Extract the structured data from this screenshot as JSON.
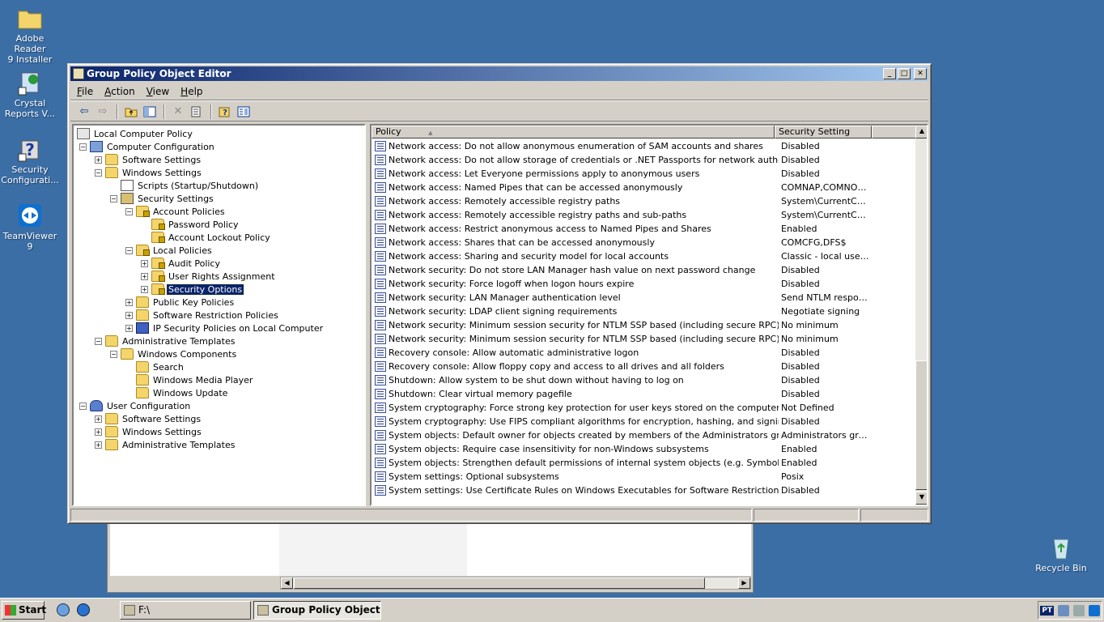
{
  "desktop": {
    "icons": [
      {
        "label": "Adobe Reader\n9 Installer",
        "icon": "folder-icon"
      },
      {
        "label": "Crystal\nReports V...",
        "icon": "crystal-reports-icon"
      },
      {
        "label": "Security\nConfigurati...",
        "icon": "security-config-icon"
      },
      {
        "label": "TeamViewer 9",
        "icon": "teamviewer-icon"
      },
      {
        "label": "Recycle Bin",
        "icon": "recycle-bin-icon"
      }
    ]
  },
  "window": {
    "title": "Group Policy Object Editor",
    "controls": {
      "minimize": "_",
      "maximize": "□",
      "close": "✕"
    },
    "menus": [
      "File",
      "Action",
      "View",
      "Help"
    ],
    "toolbar_icons": [
      "back-icon",
      "forward-icon",
      "up-folder-icon",
      "show-hide-tree-icon",
      "delete-icon",
      "export-list-icon",
      "help-icon",
      "properties-icon"
    ],
    "tree": [
      {
        "label": "Local Computer Policy",
        "depth": 0,
        "expander": "",
        "icon": "policy"
      },
      {
        "label": "Computer Configuration",
        "depth": 1,
        "expander": "−",
        "icon": "computer"
      },
      {
        "label": "Software Settings",
        "depth": 2,
        "expander": "+",
        "icon": "folder"
      },
      {
        "label": "Windows Settings",
        "depth": 2,
        "expander": "−",
        "icon": "folder"
      },
      {
        "label": "Scripts (Startup/Shutdown)",
        "depth": 3,
        "expander": "",
        "icon": "doc"
      },
      {
        "label": "Security Settings",
        "depth": 3,
        "expander": "−",
        "icon": "sec"
      },
      {
        "label": "Account Policies",
        "depth": 4,
        "expander": "−",
        "icon": "folderlock"
      },
      {
        "label": "Password Policy",
        "depth": 5,
        "expander": "",
        "icon": "folderlock"
      },
      {
        "label": "Account Lockout Policy",
        "depth": 5,
        "expander": "",
        "icon": "folderlock"
      },
      {
        "label": "Local Policies",
        "depth": 4,
        "expander": "−",
        "icon": "folderlock"
      },
      {
        "label": "Audit Policy",
        "depth": 5,
        "expander": "+",
        "icon": "folderlock"
      },
      {
        "label": "User Rights Assignment",
        "depth": 5,
        "expander": "+",
        "icon": "folderlock"
      },
      {
        "label": "Security Options",
        "depth": 5,
        "expander": "+",
        "icon": "folderlock",
        "selected": true
      },
      {
        "label": "Public Key Policies",
        "depth": 4,
        "expander": "+",
        "icon": "folder"
      },
      {
        "label": "Software Restriction Policies",
        "depth": 4,
        "expander": "+",
        "icon": "folder"
      },
      {
        "label": "IP Security Policies on Local Computer",
        "depth": 4,
        "expander": "+",
        "icon": "ip"
      },
      {
        "label": "Administrative Templates",
        "depth": 2,
        "expander": "−",
        "icon": "folder"
      },
      {
        "label": "Windows Components",
        "depth": 3,
        "expander": "−",
        "icon": "folder"
      },
      {
        "label": "Search",
        "depth": 4,
        "expander": "",
        "icon": "folder"
      },
      {
        "label": "Windows Media Player",
        "depth": 4,
        "expander": "",
        "icon": "folder"
      },
      {
        "label": "Windows Update",
        "depth": 4,
        "expander": "",
        "icon": "folder"
      },
      {
        "label": "User Configuration",
        "depth": 1,
        "expander": "−",
        "icon": "user"
      },
      {
        "label": "Software Settings",
        "depth": 2,
        "expander": "+",
        "icon": "folder"
      },
      {
        "label": "Windows Settings",
        "depth": 2,
        "expander": "+",
        "icon": "folder"
      },
      {
        "label": "Administrative Templates",
        "depth": 2,
        "expander": "+",
        "icon": "folder"
      }
    ],
    "list": {
      "columns": [
        "Policy",
        "Security Setting"
      ],
      "sort_indicator": "▲",
      "rows": [
        {
          "policy": "Network access: Do not allow anonymous enumeration of SAM accounts and shares",
          "setting": "Disabled"
        },
        {
          "policy": "Network access: Do not allow storage of credentials or .NET Passports for network authentication",
          "setting": "Disabled"
        },
        {
          "policy": "Network access: Let Everyone permissions apply to anonymous users",
          "setting": "Disabled"
        },
        {
          "policy": "Network access: Named Pipes that can be accessed anonymously",
          "setting": "COMNAP,COMNOD..."
        },
        {
          "policy": "Network access: Remotely accessible registry paths",
          "setting": "System\\CurrentCon..."
        },
        {
          "policy": "Network access: Remotely accessible registry paths and sub-paths",
          "setting": "System\\CurrentCon..."
        },
        {
          "policy": "Network access: Restrict anonymous access to Named Pipes and Shares",
          "setting": "Enabled"
        },
        {
          "policy": "Network access: Shares that can be accessed anonymously",
          "setting": "COMCFG,DFS$"
        },
        {
          "policy": "Network access: Sharing and security model for local accounts",
          "setting": "Classic - local users ..."
        },
        {
          "policy": "Network security: Do not store LAN Manager hash value on next password change",
          "setting": "Disabled"
        },
        {
          "policy": "Network security: Force logoff when logon hours expire",
          "setting": "Disabled"
        },
        {
          "policy": "Network security: LAN Manager authentication level",
          "setting": "Send NTLM respons..."
        },
        {
          "policy": "Network security: LDAP client signing requirements",
          "setting": "Negotiate signing"
        },
        {
          "policy": "Network security: Minimum session security for NTLM SSP based (including secure RPC) clients",
          "setting": "No minimum"
        },
        {
          "policy": "Network security: Minimum session security for NTLM SSP based (including secure RPC) servers",
          "setting": "No minimum"
        },
        {
          "policy": "Recovery console: Allow automatic administrative logon",
          "setting": "Disabled"
        },
        {
          "policy": "Recovery console: Allow floppy copy and access to all drives and all folders",
          "setting": "Disabled"
        },
        {
          "policy": "Shutdown: Allow system to be shut down without having to log on",
          "setting": "Disabled"
        },
        {
          "policy": "Shutdown: Clear virtual memory pagefile",
          "setting": "Disabled"
        },
        {
          "policy": "System cryptography: Force strong key protection for user keys stored on the computer",
          "setting": "Not Defined"
        },
        {
          "policy": "System cryptography: Use FIPS compliant algorithms for encryption, hashing, and signing",
          "setting": "Disabled"
        },
        {
          "policy": "System objects: Default owner for objects created by members of the Administrators group",
          "setting": "Administrators group"
        },
        {
          "policy": "System objects: Require case insensitivity for non-Windows subsystems",
          "setting": "Enabled"
        },
        {
          "policy": "System objects: Strengthen default permissions of internal system objects (e.g. Symbolic Links)",
          "setting": "Enabled"
        },
        {
          "policy": "System settings: Optional subsystems",
          "setting": "Posix"
        },
        {
          "policy": "System settings: Use Certificate Rules on Windows Executables for Software Restriction Policies",
          "setting": "Disabled"
        }
      ]
    }
  },
  "taskbar": {
    "start_label": "Start",
    "tasks": [
      {
        "label": "F:\\",
        "active": false
      },
      {
        "label": "Group Policy Object E...",
        "active": true
      }
    ],
    "tray_lang": "PT"
  },
  "colors": {
    "desktop": "#3a6ea5",
    "titlebar_start": "#0a246a",
    "titlebar_end": "#a6caf0",
    "selection": "#0a246a"
  }
}
